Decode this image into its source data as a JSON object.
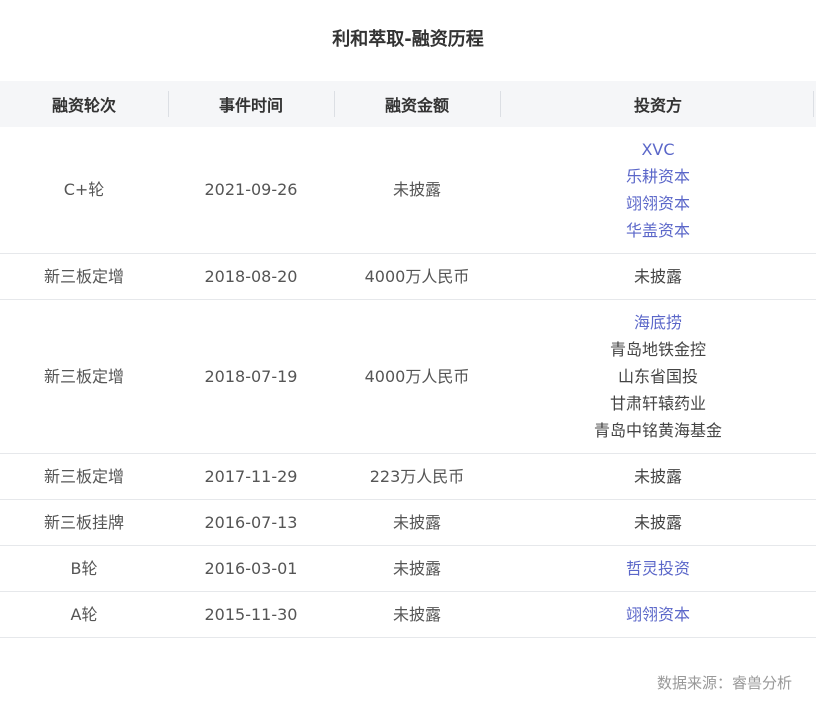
{
  "title": "利和萃取-融资历程",
  "table": {
    "headers": [
      "融资轮次",
      "事件时间",
      "融资金额",
      "投资方"
    ],
    "rows": [
      {
        "round": "C+轮",
        "date": "2021-09-26",
        "amount": "未披露",
        "investors": [
          {
            "name": "XVC",
            "link": true
          },
          {
            "name": "乐耕资本",
            "link": true
          },
          {
            "name": "翊翎资本",
            "link": true
          },
          {
            "name": "华盖资本",
            "link": true
          }
        ]
      },
      {
        "round": "新三板定增",
        "date": "2018-08-20",
        "amount": "4000万人民币",
        "investors": [
          {
            "name": "未披露",
            "link": false
          }
        ]
      },
      {
        "round": "新三板定增",
        "date": "2018-07-19",
        "amount": "4000万人民币",
        "investors": [
          {
            "name": "海底捞",
            "link": true
          },
          {
            "name": "青岛地铁金控",
            "link": false
          },
          {
            "name": "山东省国投",
            "link": false
          },
          {
            "name": "甘肃轩辕药业",
            "link": false
          },
          {
            "name": "青岛中铭黄海基金",
            "link": false
          }
        ]
      },
      {
        "round": "新三板定增",
        "date": "2017-11-29",
        "amount": "223万人民币",
        "investors": [
          {
            "name": "未披露",
            "link": false
          }
        ]
      },
      {
        "round": "新三板挂牌",
        "date": "2016-07-13",
        "amount": "未披露",
        "investors": [
          {
            "name": "未披露",
            "link": false
          }
        ]
      },
      {
        "round": "B轮",
        "date": "2016-03-01",
        "amount": "未披露",
        "investors": [
          {
            "name": "哲灵投资",
            "link": true
          }
        ]
      },
      {
        "round": "A轮",
        "date": "2015-11-30",
        "amount": "未披露",
        "investors": [
          {
            "name": "翊翎资本",
            "link": true
          }
        ]
      }
    ]
  },
  "source": "数据来源：睿兽分析",
  "colors": {
    "link": "#5b67c9",
    "header_bg": "#f5f6f8",
    "text": "#555555"
  }
}
